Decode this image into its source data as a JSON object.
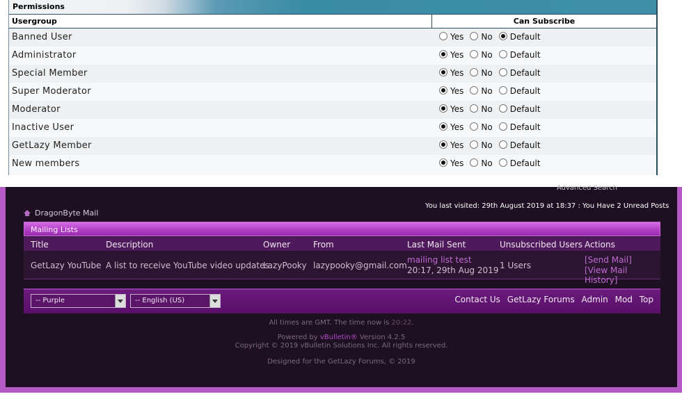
{
  "permissions": {
    "title": "Permissions",
    "col_usergroup": "Usergroup",
    "col_subscribe": "Can Subscribe",
    "option_yes": "Yes",
    "option_no": "No",
    "option_default": "Default",
    "rows": [
      {
        "label": "Banned User",
        "selected": "default"
      },
      {
        "label": "Administrator",
        "selected": "yes"
      },
      {
        "label": "Special Member",
        "selected": "yes"
      },
      {
        "label": "Super Moderator",
        "selected": "yes"
      },
      {
        "label": "Moderator",
        "selected": "yes"
      },
      {
        "label": "Inactive User",
        "selected": "yes"
      },
      {
        "label": "GetLazy Member",
        "selected": "yes"
      },
      {
        "label": "New members",
        "selected": "yes"
      }
    ]
  },
  "forum": {
    "advanced_search": "Advanced Search",
    "breadcrumb": "DragonByte Mail",
    "last_visited": "You last visited: 29th August 2019 at 18:37 : You Have 2 Unread Posts",
    "mailing_lists": {
      "title": "Mailing Lists",
      "headers": {
        "title": "Title",
        "description": "Description",
        "owner": "Owner",
        "from": "From",
        "last_mail": "Last Mail Sent",
        "unsubscribed": "Unsubscribed Users",
        "actions": "Actions"
      },
      "row": {
        "title": "GetLazy YouTube",
        "description": "A list to receive YouTube video updates",
        "owner": "LazyPooky",
        "from": "lazypooky@gmail.com",
        "last_mail_subject": "mailing list test",
        "last_mail_time": "20:17, 29th Aug 2019",
        "unsubscribed": "1 Users",
        "action_send": "[Send Mail]",
        "action_history": "[View Mail History]"
      }
    },
    "style_select": "-- Purple",
    "language_select": "-- English (US)",
    "footer_links": [
      "Contact Us",
      "GetLazy Forums",
      "Admin",
      "Mod",
      "Top"
    ],
    "timezone_text": "All times are GMT. The time now is",
    "time_now": "20:22",
    "timezone_end": ".",
    "powered_by": "Powered by",
    "vbulletin": "vBulletin®",
    "version": "Version 4.2.5",
    "copyright": "Copyright © 2019 vBulletin Solutions Inc. All rights reserved.",
    "designed_for": "Designed for the GetLazy Forums, © 2019"
  },
  "colors": {
    "permissions_header_accent": "#3e8ea8",
    "forum_background": "#1e0f22",
    "forum_border": "#b55ac4",
    "mailing_list_header": "#b03fc4",
    "link": "#c06ad4"
  }
}
